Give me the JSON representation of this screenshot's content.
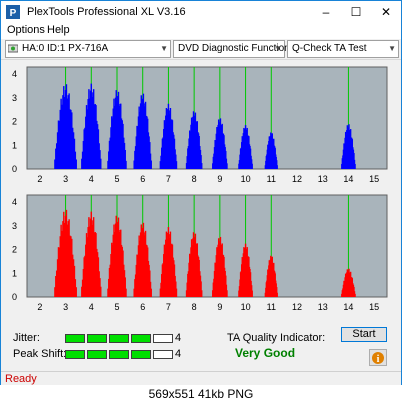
{
  "window": {
    "title": "PlexTools Professional XL V3.16",
    "minimize": "–",
    "maximize": "☐",
    "close": "✕"
  },
  "menu": {
    "options": "Options",
    "help": "Help"
  },
  "toolbar": {
    "drive": "HA:0 ID:1  PX-716A",
    "function": "DVD Diagnostic Functions",
    "test": "Q-Check TA Test"
  },
  "colors": {
    "top_series": "#0000ff",
    "bottom_series": "#ff0000",
    "gridline": "#00c800",
    "plot_bg": "#a9b4bb"
  },
  "chart_data": [
    {
      "type": "bar",
      "title": "",
      "xlabel": "",
      "ylabel": "",
      "xlim": [
        1.5,
        15.5
      ],
      "ylim": [
        0,
        4.3
      ],
      "xticks": [
        2,
        3,
        4,
        5,
        6,
        7,
        8,
        9,
        10,
        11,
        12,
        13,
        14,
        15
      ],
      "yticks": [
        0,
        1,
        2,
        3,
        4
      ],
      "gridlines_x": [
        3,
        4,
        5,
        6,
        7,
        8,
        9,
        10,
        11,
        14
      ],
      "series": [
        {
          "peaks": [
            {
              "center": 3.0,
              "height": 3.6,
              "width": 0.45
            },
            {
              "center": 4.0,
              "height": 3.6,
              "width": 0.4
            },
            {
              "center": 5.0,
              "height": 3.35,
              "width": 0.38
            },
            {
              "center": 6.0,
              "height": 3.2,
              "width": 0.36
            },
            {
              "center": 7.0,
              "height": 2.75,
              "width": 0.34
            },
            {
              "center": 8.0,
              "height": 2.45,
              "width": 0.32
            },
            {
              "center": 9.0,
              "height": 2.15,
              "width": 0.3
            },
            {
              "center": 10.0,
              "height": 1.85,
              "width": 0.28
            },
            {
              "center": 11.0,
              "height": 1.55,
              "width": 0.25
            },
            {
              "center": 14.0,
              "height": 1.9,
              "width": 0.28
            }
          ]
        }
      ]
    },
    {
      "type": "bar",
      "title": "",
      "xlabel": "",
      "ylabel": "",
      "xlim": [
        1.5,
        15.5
      ],
      "ylim": [
        0,
        4.3
      ],
      "xticks": [
        2,
        3,
        4,
        5,
        6,
        7,
        8,
        9,
        10,
        11,
        12,
        13,
        14,
        15
      ],
      "yticks": [
        0,
        1,
        2,
        3,
        4
      ],
      "gridlines_x": [
        3,
        4,
        5,
        6,
        7,
        8,
        9,
        10,
        11,
        14
      ],
      "series": [
        {
          "peaks": [
            {
              "center": 3.0,
              "height": 3.7,
              "width": 0.45
            },
            {
              "center": 4.0,
              "height": 3.6,
              "width": 0.4
            },
            {
              "center": 5.0,
              "height": 3.45,
              "width": 0.38
            },
            {
              "center": 6.0,
              "height": 3.15,
              "width": 0.36
            },
            {
              "center": 7.0,
              "height": 2.95,
              "width": 0.34
            },
            {
              "center": 8.0,
              "height": 2.75,
              "width": 0.32
            },
            {
              "center": 9.0,
              "height": 2.55,
              "width": 0.3
            },
            {
              "center": 10.0,
              "height": 2.25,
              "width": 0.28
            },
            {
              "center": 11.0,
              "height": 1.75,
              "width": 0.25
            },
            {
              "center": 14.0,
              "height": 1.2,
              "width": 0.28
            }
          ]
        }
      ]
    }
  ],
  "metrics": {
    "jitter_label": "Jitter:",
    "jitter_value": "4",
    "jitter_level": 4,
    "peak_shift_label": "Peak Shift:",
    "peak_shift_value": "4",
    "peak_shift_level": 4,
    "bar_cells_total": 5
  },
  "quality": {
    "label": "TA Quality Indicator:",
    "value": "Very Good",
    "value_color": "#008000"
  },
  "buttons": {
    "start": "Start",
    "info": "i"
  },
  "status": {
    "text": "Ready",
    "color": "#cc0000"
  },
  "caption": "569x551  41kb  PNG"
}
